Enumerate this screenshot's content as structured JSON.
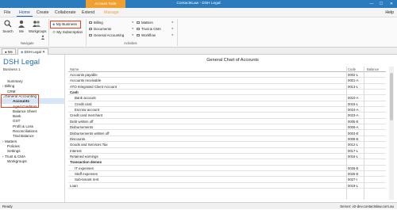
{
  "titlebar": {
    "context_tab": "Account Tools",
    "title": "ContactsLaw - DSH Legal",
    "min": "—",
    "max": "☐",
    "close": "✕"
  },
  "menu": {
    "file": "File",
    "home": "Home",
    "create": "Create",
    "collaborate": "Collaborate",
    "extend": "Extend",
    "manage": "Manage",
    "help": "Help"
  },
  "ribbon": {
    "search": "Search",
    "me": "Me",
    "workgroups": "Workgroups",
    "people": "…",
    "navigate_label": "Navigate",
    "my_business": "My Business",
    "my_subscription": "My Subscription",
    "activities_label": "Activities",
    "dropdowns": [
      "Billing",
      "Documents",
      "General Accounting",
      "Matters",
      "Trust & CMA",
      "Workflow"
    ]
  },
  "tabs": [
    "Me",
    "DSH Legal"
  ],
  "sidebar": {
    "title": "DSH Legal",
    "subtitle": "Business 1",
    "items": [
      {
        "label": "Summary",
        "indent": 1,
        "exp": ""
      },
      {
        "label": "Billing",
        "indent": 0,
        "exp": "›"
      },
      {
        "label": "CRM",
        "indent": 1,
        "exp": ""
      },
      {
        "label": "General Accounting",
        "indent": 0,
        "exp": "⌄"
      },
      {
        "label": "Accounts",
        "indent": 2,
        "exp": "",
        "selected": true
      },
      {
        "label": "Aged Creditors",
        "indent": 2,
        "exp": ""
      },
      {
        "label": "Balance Sheet",
        "indent": 2,
        "exp": ""
      },
      {
        "label": "Bank",
        "indent": 2,
        "exp": ""
      },
      {
        "label": "GST",
        "indent": 2,
        "exp": ""
      },
      {
        "label": "Profit & Loss",
        "indent": 2,
        "exp": ""
      },
      {
        "label": "Reconciliations",
        "indent": 2,
        "exp": ""
      },
      {
        "label": "Trial Balance",
        "indent": 2,
        "exp": ""
      },
      {
        "label": "Matters",
        "indent": 0,
        "exp": "›"
      },
      {
        "label": "Policies",
        "indent": 1,
        "exp": ""
      },
      {
        "label": "Settings",
        "indent": 1,
        "exp": ""
      },
      {
        "label": "Trust & CMA",
        "indent": 0,
        "exp": "›"
      },
      {
        "label": "Workgroups",
        "indent": 1,
        "exp": ""
      }
    ]
  },
  "main": {
    "title": "General Chart of Accounts",
    "columns": {
      "name": "Name",
      "code": "Code",
      "balance": "Balance"
    },
    "rows": [
      {
        "name": "Accounts payable",
        "code": "0002-L",
        "level": 0,
        "bold": false
      },
      {
        "name": "Accounts receivable",
        "code": "0001-A",
        "level": 0,
        "bold": false
      },
      {
        "name": "ATO Integrated Client Account",
        "code": "0013-L",
        "level": 0,
        "bold": false
      },
      {
        "name": "Cash",
        "code": "",
        "level": 0,
        "bold": true
      },
      {
        "name": "Bank account",
        "code": "0010-A",
        "level": 1,
        "bold": false
      },
      {
        "name": "Credit card",
        "code": "0015-L",
        "level": 1,
        "bold": false
      },
      {
        "name": "Escrow account",
        "code": "0024-A",
        "level": 1,
        "bold": false
      },
      {
        "name": "Credit card merchant",
        "code": "0023-A",
        "level": 0,
        "bold": false
      },
      {
        "name": "Debt written off",
        "code": "0005-E",
        "level": 0,
        "bold": false
      },
      {
        "name": "Disbursements",
        "code": "0006-A",
        "level": 0,
        "bold": false
      },
      {
        "name": "Disbursements written off",
        "code": "0003-E",
        "level": 0,
        "bold": false
      },
      {
        "name": "Discounts",
        "code": "0008-E",
        "level": 0,
        "bold": false
      },
      {
        "name": "Goods and Services Tax",
        "code": "0012-L",
        "level": 0,
        "bold": false
      },
      {
        "name": "Interest",
        "code": "0017-L",
        "level": 0,
        "bold": false
      },
      {
        "name": "Retained earnings",
        "code": "0016-L",
        "level": 0,
        "bold": false
      },
      {
        "name": "Transaction demos",
        "code": "",
        "level": 0,
        "bold": true
      },
      {
        "name": "IT expenses",
        "code": "0026-E",
        "level": 1,
        "bold": false
      },
      {
        "name": "Staff expenses",
        "code": "0025-E",
        "level": 1,
        "bold": false
      },
      {
        "name": "Sub-tenant rent",
        "code": "0027-I",
        "level": 1,
        "bold": false
      },
      {
        "name": "Loan",
        "code": "0019-L",
        "level": 0,
        "bold": false
      }
    ]
  },
  "status": {
    "left": "Ready",
    "right": "Server: v2-dev.contactslaw.com.au"
  },
  "colors": {
    "accent": "#2b7bbf",
    "highlight": "#e8401c",
    "context": "#f0a030"
  }
}
